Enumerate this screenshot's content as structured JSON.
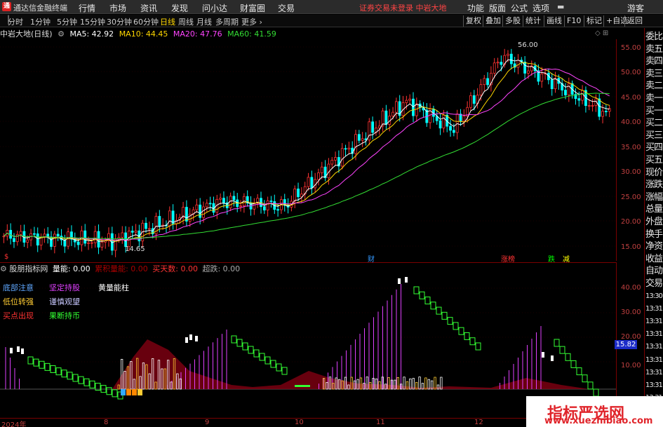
{
  "app": {
    "logo_glyph": "通",
    "title": "通达信金融终端"
  },
  "menu": {
    "items": [
      "行情",
      "市场",
      "资讯",
      "发现",
      "问小达",
      "财富圈",
      "交易"
    ],
    "notice": "证券交易未登录  中岩大地",
    "right_items": [
      "功能",
      "版面",
      "公式",
      "选项"
    ],
    "guest": "游客"
  },
  "periods": [
    "分时",
    "1分钟",
    "5分钟",
    "15分钟",
    "30分钟",
    "60分钟",
    "日线",
    "周线",
    "月线",
    "多周期",
    "更多 ›"
  ],
  "active_period": "日线",
  "tools": [
    "复权",
    "叠加",
    "多股",
    "统计",
    "画线",
    "F10",
    "标记",
    "+自选",
    "返回"
  ],
  "stock": {
    "name": "中岩大地(日线)"
  },
  "ma_legend": [
    {
      "label": "MA5: 42.92",
      "color": "#ffffff"
    },
    {
      "label": "MA10: 44.45",
      "color": "#ffd700"
    },
    {
      "label": "MA20: 47.76",
      "color": "#ff44ff"
    },
    {
      "label": "MA60: 41.59",
      "color": "#33dd33"
    }
  ],
  "price_axis": [
    "55.00",
    "50.00",
    "45.00",
    "40.00",
    "35.00",
    "30.00",
    "25.00",
    "20.00",
    "15.00"
  ],
  "annotations": {
    "high": "56.00",
    "low": "14.65"
  },
  "event_marks": [
    {
      "label": "$",
      "color": "#ff3333"
    },
    {
      "label": "财",
      "color": "#3399ff"
    },
    {
      "label": "涨榜",
      "color": "#ff3333"
    },
    {
      "label": "跌",
      "color": "#00ff00"
    },
    {
      "label": "减",
      "color": "#ffff00"
    }
  ],
  "right_column": [
    "委比",
    "卖五",
    "卖四",
    "卖三",
    "卖二",
    "卖一",
    "买一",
    "买二",
    "买三",
    "买四",
    "买五",
    "现价",
    "涨跌",
    "涨幅",
    "总量",
    "外盘",
    "换手",
    "净资",
    "收益",
    "自动",
    "交易",
    "13:30",
    "13:31",
    "13:31",
    "13:31",
    "13:31",
    "13:31",
    "13:31",
    "13:31",
    "13:31",
    "13:31"
  ],
  "indicator": {
    "name": "股朋指标网",
    "fields": [
      {
        "label": "量能: 0.00",
        "color": "#ffffff"
      },
      {
        "label": "累积量能: 0.00",
        "color": "#aa0000"
      },
      {
        "label": "买天数: 0.00",
        "color": "#ff3333"
      },
      {
        "label": "超跌: 0.00",
        "color": "#aaaaaa"
      }
    ],
    "axis": [
      "40.00",
      "30.00",
      "20.00",
      "10.00"
    ],
    "current_value": "15.82",
    "legend": [
      {
        "label": "底部注意",
        "color": "#5fa8ff"
      },
      {
        "label": "坚定持股",
        "color": "#e040ff"
      },
      {
        "label": "黄量能柱",
        "color": "#ffffff"
      },
      {
        "label": "低位转强",
        "color": "#ffcc33"
      },
      {
        "label": "谨慎观望",
        "color": "#c8c8ff"
      },
      {
        "label": "买点出现",
        "color": "#ff3333"
      },
      {
        "label": "果断持币",
        "color": "#33ff33"
      }
    ]
  },
  "dates": [
    "2024年",
    "8",
    "9",
    "10",
    "11",
    "12"
  ],
  "watermark": {
    "title": "指标严选网",
    "url": "www.xuezhibiao.com"
  },
  "colors": {
    "up": "#ff3333",
    "up_fill": "#000000",
    "down": "#00ffff",
    "ma5": "#ffffff",
    "ma10": "#ffd700",
    "ma20": "#ff44ff",
    "ma60": "#33dd33"
  }
}
